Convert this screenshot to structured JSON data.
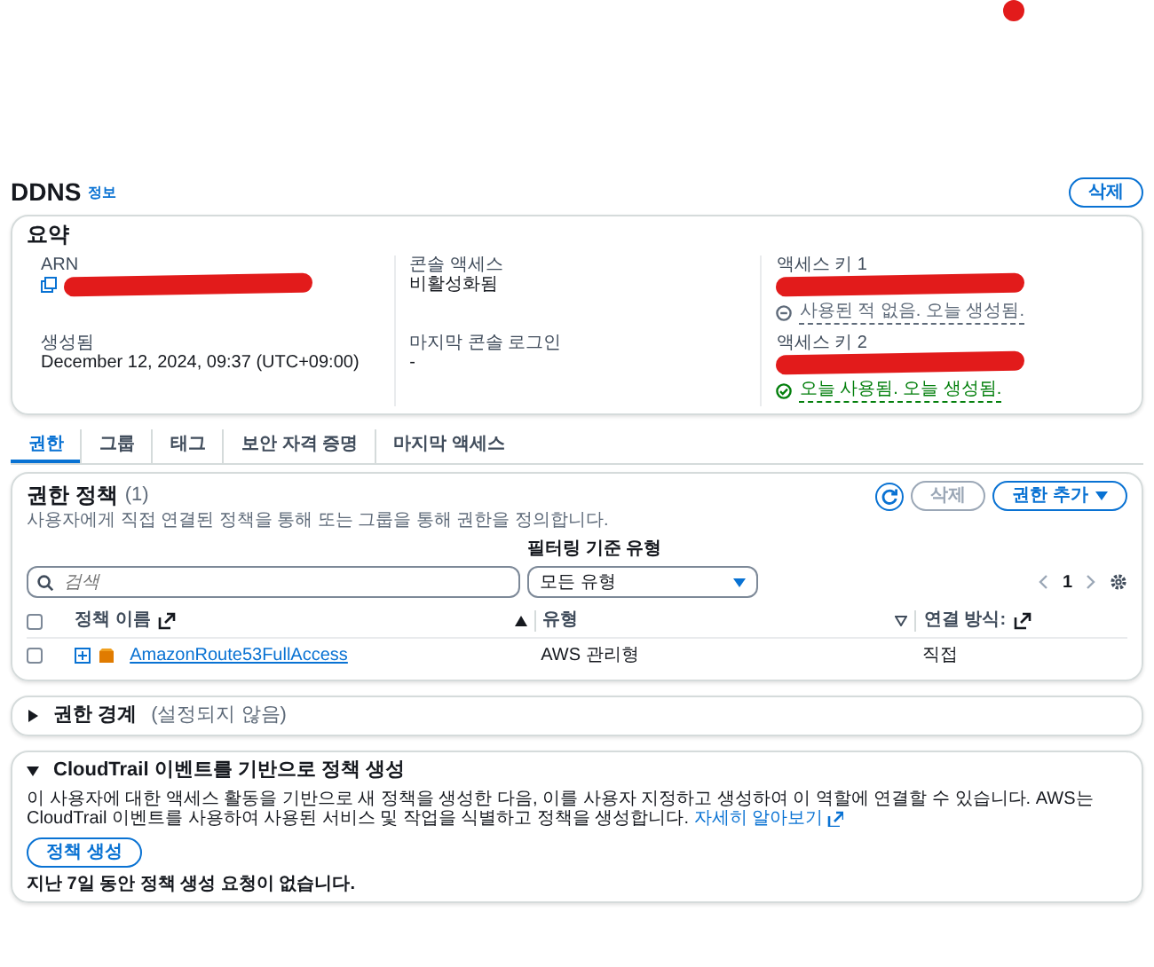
{
  "header": {
    "title": "DDNS",
    "info_link": "정보",
    "delete_button": "삭제"
  },
  "summary": {
    "title": "요약",
    "fields": [
      {
        "label": "ARN",
        "redacted": true,
        "kind": "arn"
      },
      {
        "label": "콘솔 액세스",
        "value": "비활성화됨",
        "redacted": false,
        "kind": "text"
      },
      {
        "label": "액세스 키 1",
        "redacted": true,
        "kind": "key",
        "status": "사용된 적 없음. 오늘 생성됨.",
        "used": false
      },
      {
        "label": "생성됨",
        "value": "December 12, 2024, 09:37 (UTC+09:00)",
        "redacted": false,
        "kind": "text"
      },
      {
        "label": "마지막 콘솔 로그인",
        "value": "-",
        "redacted": false,
        "kind": "text"
      },
      {
        "label": "액세스 키 2",
        "redacted": true,
        "kind": "key",
        "status": "오늘 사용됨. 오늘 생성됨.",
        "used": true
      }
    ]
  },
  "tabs": [
    {
      "label": "권한",
      "selected": true
    },
    {
      "label": "그룹",
      "selected": false
    },
    {
      "label": "태그",
      "selected": false
    },
    {
      "label": "보안 자격 증명",
      "selected": false
    },
    {
      "label": "마지막 액세스",
      "selected": false
    }
  ],
  "policies": {
    "title": "권한 정책",
    "count": "(1)",
    "description": "사용자에게 직접 연결된 정책을 통해 또는 그룹을 통해 권한을 정의합니다.",
    "delete_button": "삭제",
    "add_button": "권한 추가",
    "search": {
      "placeholder": "검색"
    },
    "filter": {
      "label": "필터링 기준 유형",
      "value": "모든 유형"
    },
    "page": "1",
    "select_all_checked": false,
    "columns": [
      {
        "label": "정책 이름",
        "external": true,
        "sortable": true,
        "sorted": true
      },
      {
        "label": "유형",
        "external": false,
        "sortable": true,
        "sorted": false
      },
      {
        "label": "연결 방식:",
        "external": true,
        "sortable": false
      }
    ],
    "rows": [
      {
        "checked": false,
        "name": "AmazonRoute53FullAccess",
        "type": "AWS 관리형",
        "attached_via": "직접"
      }
    ]
  },
  "boundary": {
    "title": "권한 경계",
    "note": "(설정되지 않음)",
    "expanded": false
  },
  "cloudtrail": {
    "title": "CloudTrail 이벤트를 기반으로 정책 생성",
    "expanded": true,
    "description": "이 사용자에 대한 액세스 활동을 기반으로 새 정책을 생성한 다음, 이를 사용자 지정하고 생성하여 이 역할에 연결할 수 있습니다. AWS는 CloudTrail 이벤트를 사용하여 사용된 서비스 및 작업을 식별하고 정책을 생성합니다.",
    "learn_more": "자세히 알아보기",
    "button": "정책 생성",
    "status": "지난 7일 동안 정책 생성 요청이 없습니다."
  }
}
